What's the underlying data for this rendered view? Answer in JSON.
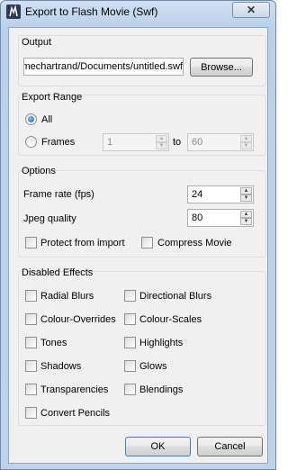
{
  "window": {
    "title": "Export to Flash Movie (Swf)",
    "close_glyph": "✕"
  },
  "output": {
    "group_title": "Output",
    "path_value": "/Users/mechartrand/Documents/untitled.swf",
    "browse_label": "Browse..."
  },
  "export_range": {
    "group_title": "Export Range",
    "all_label": "All",
    "frames_label": "Frames",
    "selected": "All",
    "from_value": "1",
    "to_label": "to",
    "to_value": "60"
  },
  "options": {
    "group_title": "Options",
    "frame_rate_label": "Frame rate (fps)",
    "frame_rate_value": "24",
    "jpeg_quality_label": "Jpeg quality",
    "jpeg_quality_value": "80",
    "protect_label": "Protect from import",
    "compress_label": "Compress Movie"
  },
  "disabled_effects": {
    "group_title": "Disabled Effects",
    "items": [
      "Radial Blurs",
      "Directional Blurs",
      "Colour-Overrides",
      "Colour-Scales",
      "Tones",
      "Highlights",
      "Shadows",
      "Glows",
      "Transparencies",
      "Blendings",
      "Convert Pencils"
    ]
  },
  "footer": {
    "ok_label": "OK",
    "cancel_label": "Cancel"
  },
  "colors": {
    "accent": "#1a5fa8",
    "frame": "#b9d1ea"
  }
}
